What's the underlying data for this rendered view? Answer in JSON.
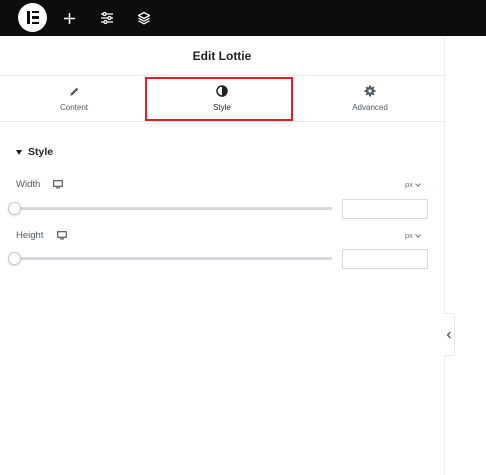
{
  "topbar": {
    "logo_icon": "elementor-logo-icon",
    "add_icon": "plus-icon",
    "settings_icon": "sliders-icon",
    "structure_icon": "layers-icon"
  },
  "panel": {
    "title": "Edit Lottie"
  },
  "tabs": [
    {
      "label": "Content",
      "icon": "pencil-icon",
      "active": false
    },
    {
      "label": "Style",
      "icon": "half-circle-icon",
      "active": true
    },
    {
      "label": "Advanced",
      "icon": "gear-icon",
      "active": false
    }
  ],
  "section": {
    "title": "Style",
    "expanded": true
  },
  "controls": {
    "width": {
      "label": "Width",
      "unit": "px",
      "value": "",
      "device_icon": "desktop-icon",
      "slider_fraction": 0
    },
    "height": {
      "label": "Height",
      "unit": "px",
      "value": "",
      "device_icon": "desktop-icon",
      "slider_fraction": 0
    }
  },
  "highlight_color": "#e01e25",
  "collapse_icon": "chevron-left-icon"
}
